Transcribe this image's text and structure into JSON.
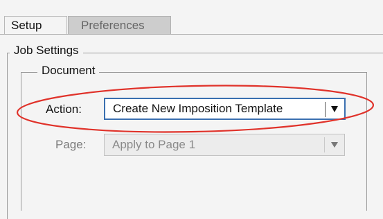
{
  "tabs": [
    {
      "label": "Setup",
      "active": true
    },
    {
      "label": "Preferences",
      "active": false
    }
  ],
  "job_settings": {
    "legend": "Job Settings",
    "document": {
      "legend": "Document",
      "action": {
        "label": "Action:",
        "value": "Create New Imposition Template",
        "enabled": true,
        "focused": true
      },
      "page": {
        "label": "Page:",
        "value": "Apply to Page 1",
        "enabled": false
      }
    }
  },
  "annotation": {
    "shape": "ellipse",
    "color": "#e0322a",
    "target": "action-row"
  },
  "icons": {
    "action_dropdown": "triangle-down-icon",
    "page_dropdown": "triangle-down-icon"
  },
  "colors": {
    "focus_border": "#3a6fb0",
    "background": "#f4f4f4",
    "inactive_tab": "#cdcdcd"
  }
}
